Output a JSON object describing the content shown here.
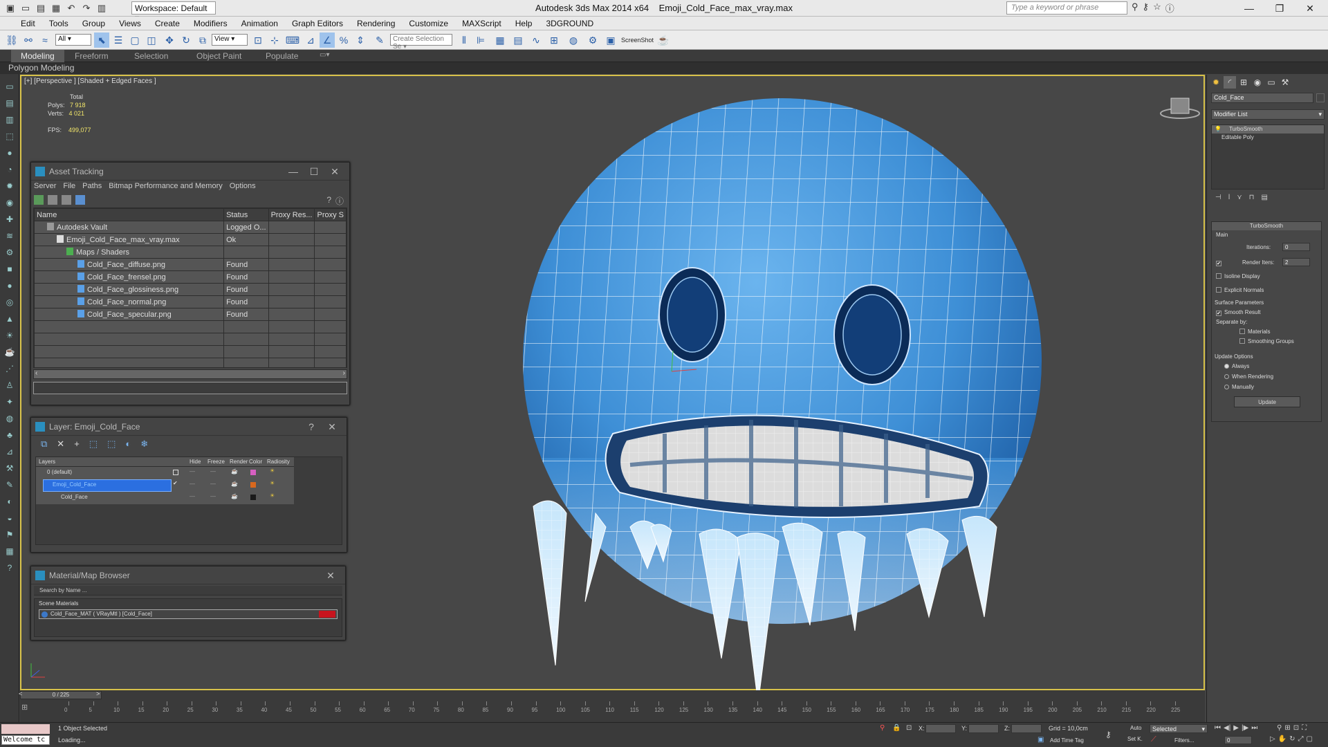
{
  "title": {
    "app": "Autodesk 3ds Max  2014 x64",
    "file": "Emoji_Cold_Face_max_vray.max",
    "workspace": "Workspace: Default",
    "search_placeholder": "Type a keyword or phrase"
  },
  "menu": [
    "Edit",
    "Tools",
    "Group",
    "Views",
    "Create",
    "Modifiers",
    "Animation",
    "Graph Editors",
    "Rendering",
    "Customize",
    "MAXScript",
    "Help",
    "3DGROUND"
  ],
  "toolbar": {
    "filter": "All",
    "refcoord": "View",
    "selset_placeholder": "Create Selection Se",
    "screenshot": "ScreenShot"
  },
  "ribbon": {
    "tabs": [
      "Modeling",
      "Freeform",
      "Selection",
      "Object Paint",
      "Populate"
    ],
    "subtab": "Polygon Modeling"
  },
  "viewport": {
    "label": "[+] [Perspective ] [Shaded + Edged Faces ]",
    "stats": {
      "total": "Total",
      "polys_label": "Polys:",
      "polys": "7 918",
      "verts_label": "Verts:",
      "verts": "4 021",
      "fps_label": "FPS:",
      "fps": "499,077"
    }
  },
  "asset_tracking": {
    "title": "Asset Tracking",
    "menu": [
      "Server",
      "File",
      "Paths",
      "Bitmap Performance and Memory",
      "Options"
    ],
    "columns": [
      "Name",
      "Status",
      "Proxy Res...",
      "Proxy S"
    ],
    "rows": [
      {
        "name": "Autodesk Vault",
        "status": "Logged O..."
      },
      {
        "name": "Emoji_Cold_Face_max_vray.max",
        "status": "Ok"
      },
      {
        "name": "Maps / Shaders",
        "status": ""
      },
      {
        "name": "Cold_Face_diffuse.png",
        "status": "Found"
      },
      {
        "name": "Cold_Face_frensel.png",
        "status": "Found"
      },
      {
        "name": "Cold_Face_glossiness.png",
        "status": "Found"
      },
      {
        "name": "Cold_Face_normal.png",
        "status": "Found"
      },
      {
        "name": "Cold_Face_specular.png",
        "status": "Found"
      }
    ]
  },
  "layer": {
    "title": "Layer: Emoji_Cold_Face",
    "columns": [
      "Layers",
      "Hide",
      "Freeze",
      "Render",
      "Color",
      "Radiosity"
    ],
    "rows": [
      {
        "name": "0 (default)",
        "color": "#d65fc0"
      },
      {
        "name": "Emoji_Cold_Face",
        "color": "#d8681e"
      },
      {
        "name": "Cold_Face",
        "color": "#1a1a1a"
      }
    ]
  },
  "material_browser": {
    "title": "Material/Map Browser",
    "search_placeholder": "Search by Name ...",
    "section": "Scene Materials",
    "item": "Cold_Face_MAT ( VRayMtl ) [Cold_Face]"
  },
  "command_panel": {
    "object_name": "Cold_Face",
    "modifier_list": "Modifier List",
    "stack": [
      "TurboSmooth",
      "Editable Poly"
    ],
    "turbosmooth": {
      "title": "TurboSmooth",
      "main": "Main",
      "iterations_label": "Iterations:",
      "iterations": "0",
      "render_iters_label": "Render Iters:",
      "render_iters": "2",
      "isoline": "Isoline Display",
      "explicit": "Explicit Normals",
      "surface": "Surface Parameters",
      "smooth_result": "Smooth Result",
      "separate_by": "Separate by:",
      "materials": "Materials",
      "smoothing_groups": "Smoothing Groups",
      "update_options": "Update Options",
      "always": "Always",
      "when_rendering": "When Rendering",
      "manually": "Manually",
      "update": "Update"
    }
  },
  "timeline": {
    "frame": "0 / 225",
    "ticks": [
      "0",
      "5",
      "10",
      "15",
      "20",
      "25",
      "30",
      "35",
      "40",
      "45",
      "50",
      "55",
      "60",
      "65",
      "70",
      "75",
      "80",
      "85",
      "90",
      "95",
      "100",
      "105",
      "110",
      "115",
      "120",
      "125",
      "130",
      "135",
      "140",
      "145",
      "150",
      "155",
      "160",
      "165",
      "170",
      "175",
      "180",
      "185",
      "190",
      "195",
      "200",
      "205",
      "210",
      "215",
      "220",
      "225"
    ]
  },
  "status": {
    "maxscript": "Welcome tc",
    "selected": "1 Object Selected",
    "loading": "Loading...",
    "x_label": "X:",
    "y_label": "Y:",
    "z_label": "Z:",
    "grid": "Grid = 10,0cm",
    "auto": "Auto",
    "selected_mode": "Selected",
    "set_key": "Set K.",
    "filters": "Filters...",
    "add_time_tag": "Add Time Tag",
    "frame_field": "0"
  },
  "colors": {
    "viewport_border": "#d8c24a",
    "face_blue": "#3b8fd8",
    "accent": "#2a8fbf"
  }
}
